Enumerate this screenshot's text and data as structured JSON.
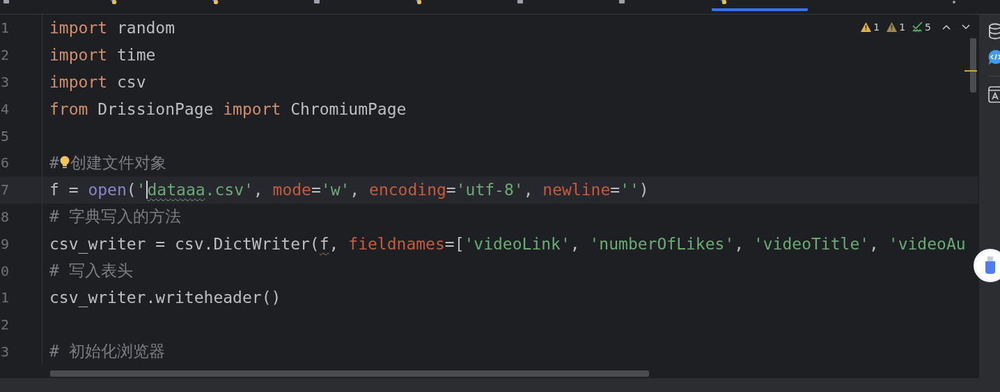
{
  "tabs": [
    {
      "kind": "csv",
      "selected": false
    },
    {
      "kind": "python",
      "selected": false
    },
    {
      "kind": "python",
      "selected": false
    },
    {
      "kind": "csv",
      "selected": false
    },
    {
      "kind": "python",
      "selected": false
    },
    {
      "kind": "csv",
      "selected": false
    },
    {
      "kind": "csv",
      "selected": false
    },
    {
      "kind": "python",
      "selected": true
    }
  ],
  "inspections": [
    {
      "kind": "warning",
      "count": "1"
    },
    {
      "kind": "weak-warning",
      "count": "1"
    },
    {
      "kind": "typo",
      "count": "5"
    }
  ],
  "editor": {
    "lines": [
      {
        "number": "1",
        "current": false,
        "tokens": [
          {
            "kind": "keyword",
            "text": "import"
          },
          {
            "kind": "plain",
            "text": " random"
          }
        ]
      },
      {
        "number": "2",
        "current": false,
        "tokens": [
          {
            "kind": "keyword",
            "text": "import"
          },
          {
            "kind": "plain",
            "text": " time"
          }
        ]
      },
      {
        "number": "3",
        "current": false,
        "tokens": [
          {
            "kind": "keyword",
            "text": "import"
          },
          {
            "kind": "plain",
            "text": " csv"
          }
        ]
      },
      {
        "number": "4",
        "current": false,
        "tokens": [
          {
            "kind": "keyword",
            "text": "from"
          },
          {
            "kind": "plain",
            "text": " DrissionPage "
          },
          {
            "kind": "keyword",
            "text": "import"
          },
          {
            "kind": "plain",
            "text": " ChromiumPage"
          }
        ]
      },
      {
        "number": "5",
        "current": false
      },
      {
        "number": "6",
        "current": false,
        "tokens": [
          {
            "kind": "comment",
            "text": "#"
          },
          {
            "kind": "bulb"
          },
          {
            "kind": "comment",
            "text": "创建文件对象"
          }
        ]
      },
      {
        "number": "7",
        "current": true,
        "tokens": [
          {
            "kind": "plain",
            "text": "f = "
          },
          {
            "kind": "builtin",
            "text": "open"
          },
          {
            "kind": "plain",
            "text": "("
          },
          {
            "kind": "string",
            "text": "'"
          },
          {
            "kind": "caret"
          },
          {
            "kind": "string-typo",
            "text": "dataaa"
          },
          {
            "kind": "string",
            "text": ".csv'"
          },
          {
            "kind": "plain",
            "text": ", "
          },
          {
            "kind": "param",
            "text": "mode"
          },
          {
            "kind": "plain",
            "text": "="
          },
          {
            "kind": "string",
            "text": "'w'"
          },
          {
            "kind": "plain",
            "text": ", "
          },
          {
            "kind": "param",
            "text": "encoding"
          },
          {
            "kind": "plain",
            "text": "="
          },
          {
            "kind": "string",
            "text": "'utf-8'"
          },
          {
            "kind": "plain",
            "text": ", "
          },
          {
            "kind": "param",
            "text": "newline"
          },
          {
            "kind": "plain",
            "text": "="
          },
          {
            "kind": "string",
            "text": "''"
          },
          {
            "kind": "plain",
            "text": ")"
          }
        ]
      },
      {
        "number": "8",
        "current": false,
        "tokens": [
          {
            "kind": "comment",
            "text": "# 字典写入的方法"
          }
        ]
      },
      {
        "number": "9",
        "current": false,
        "tokens": [
          {
            "kind": "plain",
            "text": "csv_writer = csv.DictWriter("
          },
          {
            "kind": "plain-typo",
            "text": "f"
          },
          {
            "kind": "plain",
            "text": ", "
          },
          {
            "kind": "param",
            "text": "fieldnames"
          },
          {
            "kind": "plain",
            "text": "=["
          },
          {
            "kind": "string",
            "text": "'videoLink'"
          },
          {
            "kind": "plain",
            "text": ", "
          },
          {
            "kind": "string",
            "text": "'numberOfLikes'"
          },
          {
            "kind": "plain",
            "text": ", "
          },
          {
            "kind": "string",
            "text": "'videoTitle'"
          },
          {
            "kind": "plain",
            "text": ", "
          },
          {
            "kind": "string",
            "text": "'videoAu"
          }
        ]
      },
      {
        "number": "0",
        "current": false,
        "tokens": [
          {
            "kind": "comment",
            "text": "# 写入表头"
          }
        ]
      },
      {
        "number": "1",
        "current": false,
        "tokens": [
          {
            "kind": "plain",
            "text": "csv_writer.writeheader()"
          }
        ]
      },
      {
        "number": "2",
        "current": false
      },
      {
        "number": "3",
        "current": false,
        "tokens": [
          {
            "kind": "comment",
            "text": "# 初始化浏览器"
          }
        ]
      }
    ]
  }
}
